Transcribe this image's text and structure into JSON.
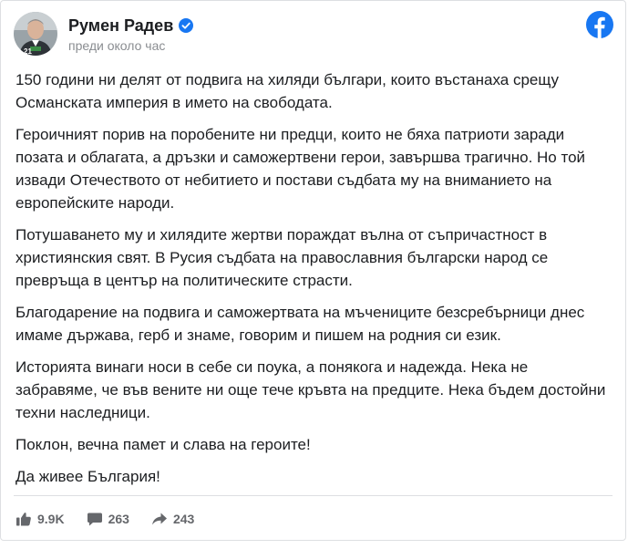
{
  "post": {
    "author": "Румен Радев",
    "timestamp": "преди около час",
    "avatar_badge": "21",
    "paragraphs": [
      "150 години ни делят от подвига на хиляди българи, които въстанаха срещу Османската империя в името на свободата.",
      "Героичният порив на поробените ни предци, които не бяха патриоти заради позата и облагата, а дръзки и саможертвени герои, завършва трагично. Но той извади Отечеството от небитието и постави съдбата му на вниманието на европейските народи.",
      "Потушаването му и хилядите жертви пораждат вълна от съпричастност в християнския свят. В Русия съдбата на православния български народ се превръща в център на политическите страсти.",
      "Благодарение на подвига и саможертвата на мъчениците безсребърници днес имаме държава, герб и знаме, говорим и пишем на родния си език.",
      "Историята винаги носи в себе си поука, а понякога и надежда. Нека не забравяме, че във вените ни още тече кръвта на предците. Нека бъдем достойни техни наследници.",
      "Поклон, вечна памет и слава на героите!",
      "Да живее България!"
    ]
  },
  "stats": {
    "likes": "9.9K",
    "comments": "263",
    "shares": "243"
  },
  "icons": {
    "verified": "verified-badge-icon",
    "brand": "facebook-logo-icon",
    "like": "thumbs-up-icon",
    "comment": "comment-bubble-icon",
    "share": "share-arrow-icon"
  },
  "colors": {
    "facebook_blue": "#1877f2",
    "text": "#1c1e21",
    "muted": "#65676b",
    "timestamp": "#8a8d91",
    "border": "#dddfe2"
  }
}
